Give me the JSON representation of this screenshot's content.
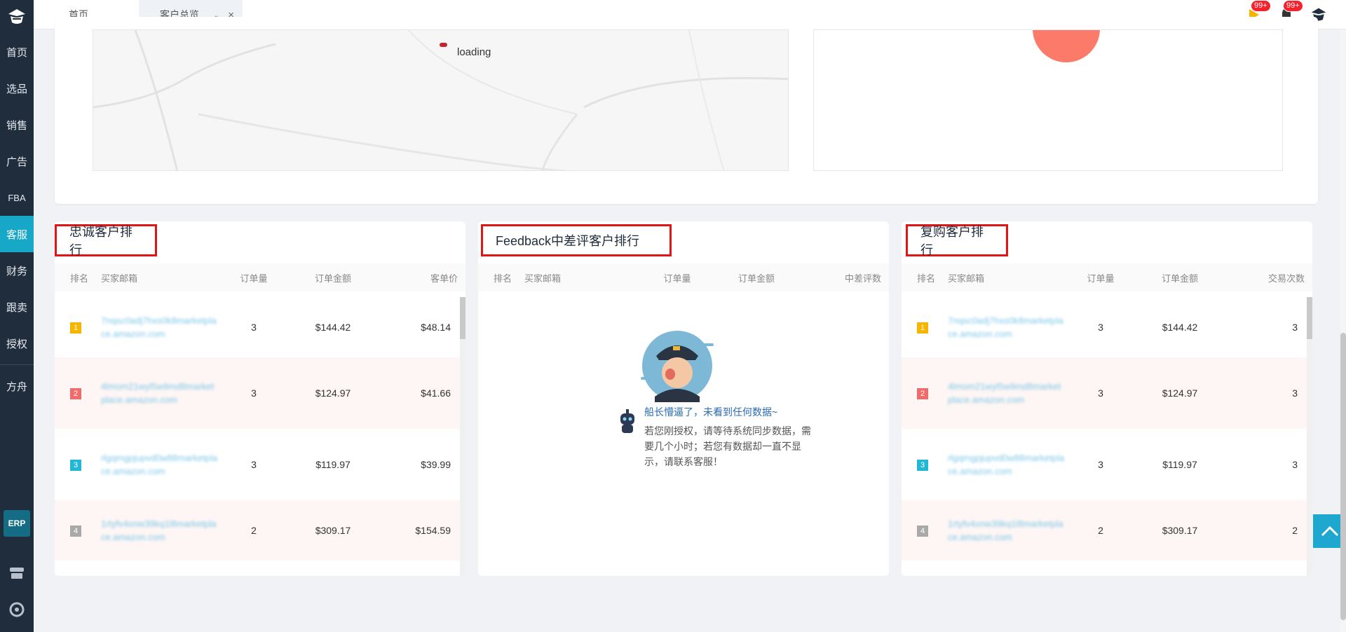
{
  "sidebar": {
    "items": [
      {
        "label": "首页"
      },
      {
        "label": "选品"
      },
      {
        "label": "销售"
      },
      {
        "label": "广告"
      },
      {
        "label": "FBA"
      },
      {
        "label": "客服"
      },
      {
        "label": "财务"
      },
      {
        "label": "跟卖"
      },
      {
        "label": "授权"
      },
      {
        "label": "方舟"
      }
    ],
    "erp": "ERP"
  },
  "tabs": {
    "home": "首页",
    "active": "客户总览"
  },
  "badges": {
    "flag": "99+",
    "bell": "99+"
  },
  "map": {
    "loading": "loading"
  },
  "loyal": {
    "title": "忠诚客户排行",
    "headers": [
      "排名",
      "买家邮箱",
      "订单量",
      "订单金额",
      "客单价"
    ],
    "rows": [
      {
        "rank": "1",
        "email": "7nqsc0adj7hxs0k8marketplace.amazon.com",
        "orders": "3",
        "amount": "$144.42",
        "unit": "$48.14"
      },
      {
        "rank": "2",
        "email": "4lmom21wyl5w9md8marketplace.amazon.com",
        "orders": "3",
        "amount": "$124.97",
        "unit": "$41.66"
      },
      {
        "rank": "3",
        "email": "rlgqmgpjupvd0w88marketplace.amazon.com",
        "orders": "3",
        "amount": "$119.97",
        "unit": "$39.99"
      },
      {
        "rank": "4",
        "email": "1rtyfv4xnw39kq1l8marketplace.amazon.com",
        "orders": "2",
        "amount": "$309.17",
        "unit": "$154.59"
      }
    ]
  },
  "feedback": {
    "title": "Feedback中差评客户排行",
    "headers": [
      "排名",
      "买家邮箱",
      "订单量",
      "订单金额",
      "中差评数"
    ],
    "empty_title": "船长懵逼了，未看到任何数据~",
    "empty_desc": "若您刚授权，请等待系统同步数据，需要几个小时；若您有数据却一直不显示，请联系客服！"
  },
  "repurchase": {
    "title": "复购客户排行",
    "headers": [
      "排名",
      "买家邮箱",
      "订单量",
      "订单金额",
      "交易次数"
    ],
    "rows": [
      {
        "rank": "1",
        "email": "7nqsc0adj7hxs0k8marketplace.amazon.com",
        "orders": "3",
        "amount": "$144.42",
        "times": "3"
      },
      {
        "rank": "2",
        "email": "4lmom21wyl5w9md8marketplace.amazon.com",
        "orders": "3",
        "amount": "$124.97",
        "times": "3"
      },
      {
        "rank": "3",
        "email": "rlgqmgpjupvd0w88marketplace.amazon.com",
        "orders": "3",
        "amount": "$119.97",
        "times": "3"
      },
      {
        "rank": "4",
        "email": "1rtyfv4xnw39kq1l8marketplace.amazon.com",
        "orders": "2",
        "amount": "$309.17",
        "times": "2"
      }
    ]
  },
  "colors": {
    "sidebar": "#1f2d3d",
    "accent": "#17a8c8",
    "highlight_border": "#e01515"
  }
}
